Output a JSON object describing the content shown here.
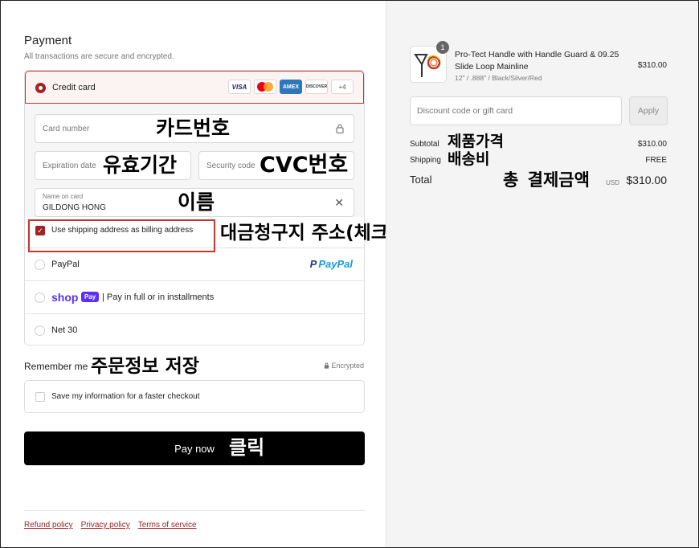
{
  "payment": {
    "title": "Payment",
    "subtitle": "All transactions are secure and encrypted.",
    "credit_card": {
      "label": "Credit card",
      "brands": [
        "VISA",
        "AMEX",
        "DISCOVER",
        "+4"
      ],
      "card_number_placeholder": "Card number",
      "expiration_placeholder": "Expiration date",
      "security_code_placeholder": "Security code",
      "name_label": "Name on card",
      "name_value": "GILDONG HONG",
      "billing_label": "Use shipping address as billing address",
      "billing_checked": true
    },
    "options": [
      {
        "label": "PayPal",
        "logo": "PayPal"
      },
      {
        "logo_shop": "shop",
        "logo_pay": "Pay",
        "label": "| Pay in full or in installments"
      },
      {
        "label": "Net 30"
      }
    ]
  },
  "remember": {
    "title": "Remember me",
    "encrypted": "Encrypted",
    "save_label": "Save my information for a faster checkout"
  },
  "pay_button": "Pay now",
  "footer": {
    "links": [
      "Refund policy",
      "Privacy policy",
      "Terms of service"
    ]
  },
  "annotations": {
    "card_number": "카드번호",
    "expiration": "유효기간",
    "cvc": "CVC번호",
    "name": "이름",
    "billing": "대금청구지 주소(체크o)",
    "remember": "주문정보 저장",
    "click": "클릭",
    "product_price": "제품가격",
    "shipping": "배송비",
    "total": "총 결제금액"
  },
  "summary": {
    "product": {
      "quantity": "1",
      "name": "Pro-Tect Handle with Handle Guard & 09.25 Slide Loop Mainline",
      "variant": "12\" / .888\" / Black/Silver/Red",
      "price": "$310.00"
    },
    "discount_placeholder": "Discount code or gift card",
    "apply": "Apply",
    "subtotal_label": "Subtotal",
    "subtotal_value": "$310.00",
    "shipping_label": "Shipping",
    "shipping_value": "FREE",
    "total_label": "Total",
    "total_currency": "USD",
    "total_value": "$310.00"
  },
  "colors": {
    "accent": "#a12222",
    "button": "#000000",
    "shop_purple": "#5a31f4"
  }
}
